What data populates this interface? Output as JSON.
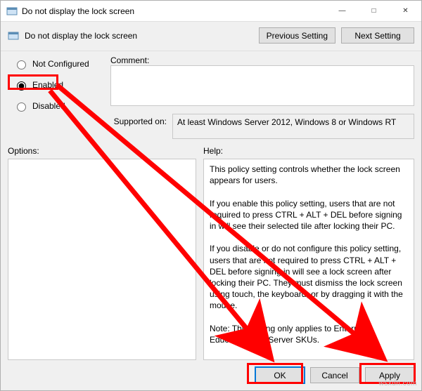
{
  "window": {
    "title": "Do not display the lock screen"
  },
  "header": {
    "title": "Do not display the lock screen",
    "prev": "Previous Setting",
    "next": "Next Setting"
  },
  "state": {
    "not_configured": "Not Configured",
    "enabled": "Enabled",
    "disabled": "Disabled",
    "selected": "enabled",
    "comment_label": "Comment:",
    "comment_value": "",
    "supported_label": "Supported on:",
    "supported_value": "At least Windows Server 2012, Windows 8 or Windows RT"
  },
  "options": {
    "label": "Options:"
  },
  "help": {
    "label": "Help:",
    "text": "This policy setting controls whether the lock screen appears for users.\n\nIf you enable this policy setting, users that are not required to press CTRL + ALT + DEL before signing in will see their selected tile after locking their PC.\n\nIf you disable or do not configure this policy setting, users that are not required to press CTRL + ALT + DEL before signing in will see a lock screen after locking their PC. They must dismiss the lock screen using touch, the keyboard, or by dragging it with the mouse.\n\nNote: This setting only applies to Enterprise, Education, and Server SKUs."
  },
  "buttons": {
    "ok": "OK",
    "cancel": "Cancel",
    "apply": "Apply"
  },
  "watermark": "wsxdn.com"
}
